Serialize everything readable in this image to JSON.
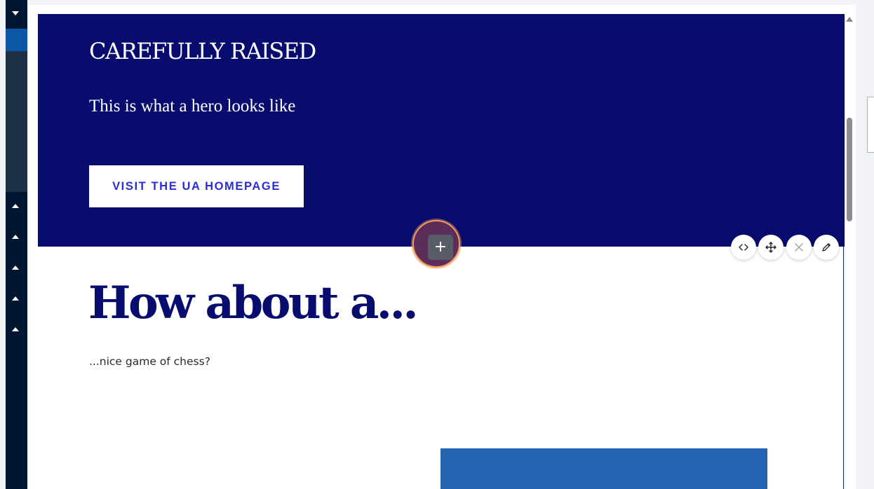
{
  "sidebar": {
    "icons": [
      "chevron-down-icon",
      "chevron-up-icon",
      "chevron-up-icon",
      "chevron-up-icon",
      "chevron-up-icon",
      "chevron-up-icon"
    ]
  },
  "hero": {
    "title": "CAREFULLY RAISED",
    "subtitle": "This is what a hero looks like",
    "button_label": "VISIT THE UA HOMEPAGE"
  },
  "section": {
    "heading": "How about a...",
    "body": "...nice game of chess?"
  },
  "editor": {
    "add_label": "+",
    "toolbar": [
      "code-icon",
      "move-icon",
      "close-icon",
      "edit-icon"
    ]
  },
  "colors": {
    "hero_bg": "#070c6e",
    "button_text": "#2b2ed3",
    "heading": "#070c6e",
    "block_blue": "#2263b2",
    "add_ring": "#f29a5b"
  }
}
